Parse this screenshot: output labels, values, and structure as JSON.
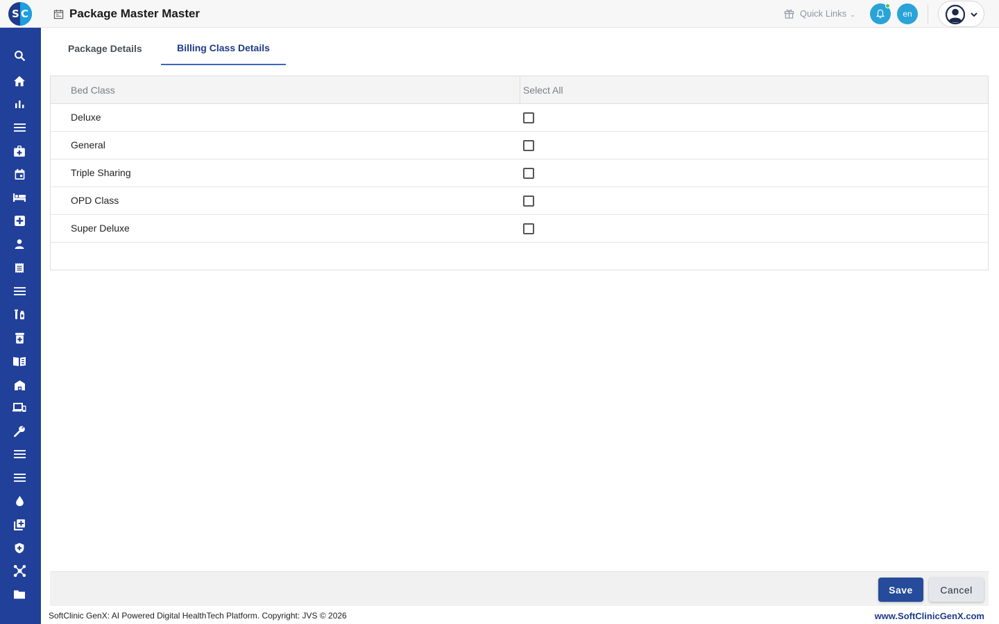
{
  "header": {
    "logo_left": "S",
    "logo_right": "C",
    "title": "Package Master Master",
    "quick_links_label": "Quick Links",
    "language": "en"
  },
  "sidebar": {
    "items": [
      {
        "icon": "search-icon"
      },
      {
        "icon": "home-icon"
      },
      {
        "icon": "bar-chart-icon"
      },
      {
        "icon": "menu-list-icon"
      },
      {
        "icon": "medical-id-icon"
      },
      {
        "icon": "calendar-icon"
      },
      {
        "icon": "bed-icon"
      },
      {
        "icon": "medical-cross-icon"
      },
      {
        "icon": "person-icon"
      },
      {
        "icon": "receipt-icon"
      },
      {
        "icon": "menu-list-icon"
      },
      {
        "icon": "lab-vials-icon"
      },
      {
        "icon": "pharmacy-icon"
      },
      {
        "icon": "book-icon"
      },
      {
        "icon": "store-icon"
      },
      {
        "icon": "devices-icon"
      },
      {
        "icon": "wrench-icon"
      },
      {
        "icon": "menu-list-icon"
      },
      {
        "icon": "menu-list-icon"
      },
      {
        "icon": "blood-drop-icon"
      },
      {
        "icon": "add-library-icon"
      },
      {
        "icon": "shield-cross-icon"
      },
      {
        "icon": "network-icon"
      },
      {
        "icon": "folder-icon"
      }
    ]
  },
  "tabs": [
    {
      "label": "Package Details",
      "active": false
    },
    {
      "label": "Billing Class Details",
      "active": true
    }
  ],
  "table": {
    "columns": [
      "Bed Class",
      "Select All"
    ],
    "rows": [
      {
        "bed_class": "Deluxe",
        "checked": false
      },
      {
        "bed_class": "General",
        "checked": false
      },
      {
        "bed_class": "Triple Sharing",
        "checked": false
      },
      {
        "bed_class": "OPD Class",
        "checked": false
      },
      {
        "bed_class": "Super Deluxe",
        "checked": false
      }
    ]
  },
  "actions": {
    "save_label": "Save",
    "cancel_label": "Cancel"
  },
  "footer": {
    "copyright": "SoftClinic GenX: AI Powered Digital HealthTech Platform. Copyright: JVS © 2026",
    "website": "www.SoftClinicGenX.com"
  },
  "colors": {
    "sidebar_bg": "#20409a",
    "accent": "#254b9a",
    "notification_blue": "#2aa3d8"
  }
}
